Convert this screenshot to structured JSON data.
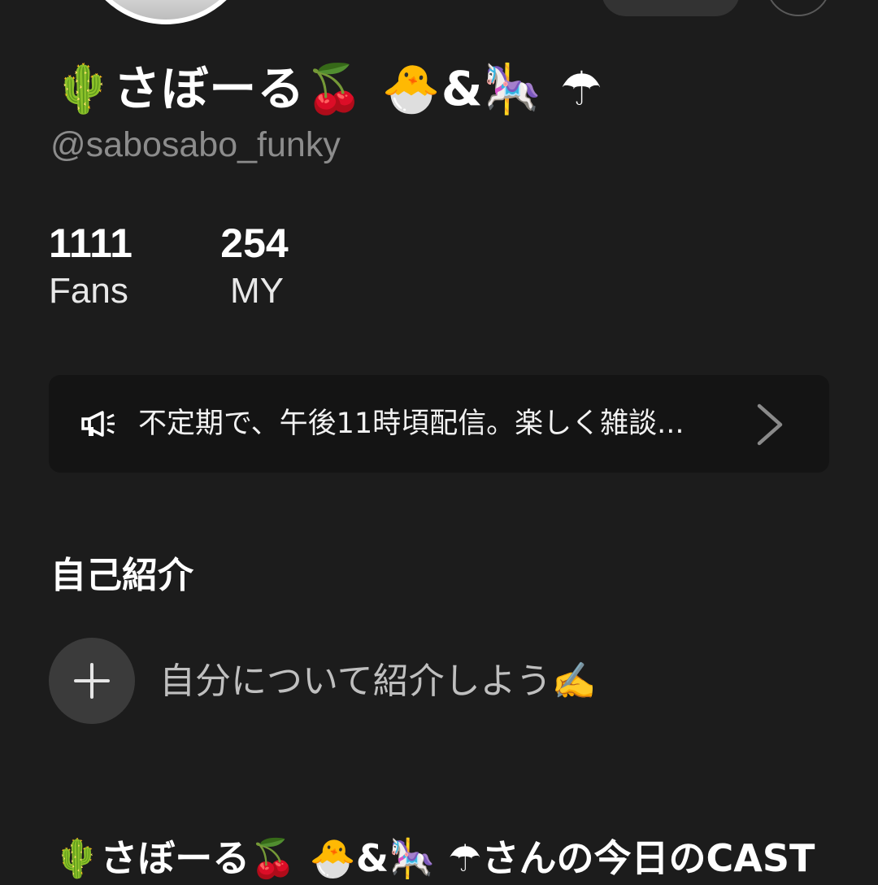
{
  "profile": {
    "display_name": "🌵さぼーる🍒 🐣&🎠 ☂",
    "handle": "@sabosabo_funky",
    "avatar_icon": "profile-avatar"
  },
  "stats": {
    "fans_value": "1111",
    "fans_label": "Fans",
    "my_value": "254",
    "my_label": "MY"
  },
  "notice": {
    "icon": "megaphone-icon",
    "text": "不定期で、午後11時頃配信。楽しく雑談...",
    "chevron": "chevron-right-icon"
  },
  "intro": {
    "section_title": "自己紹介",
    "add_icon": "plus-icon",
    "placeholder": "自分について紹介しよう✍️"
  },
  "cast": {
    "title": "🌵さぼーる🍒 🐣&🎠 ☂さんの今日のCAST"
  },
  "colors": {
    "background": "#1c1c1c",
    "card": "#141414",
    "muted_text": "#8c8c8c",
    "add_button": "#3b3b3b"
  }
}
